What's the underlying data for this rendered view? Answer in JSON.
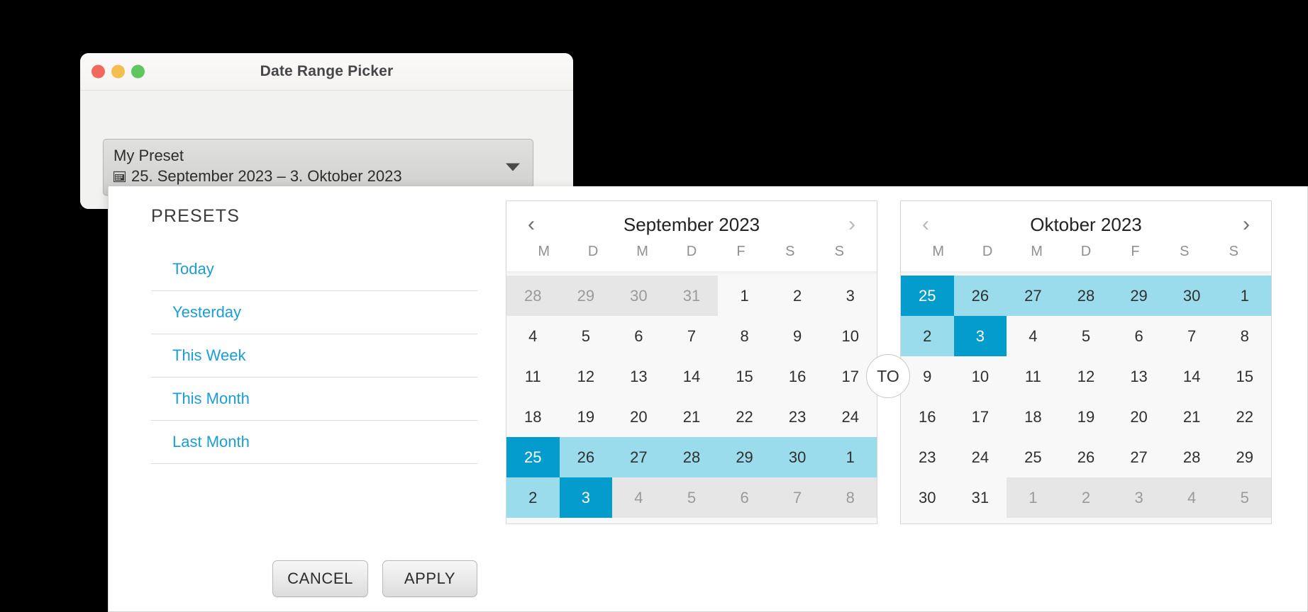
{
  "window": {
    "title": "Date Range Picker",
    "traffic_lights": [
      {
        "name": "close",
        "color": "#ef6a5d"
      },
      {
        "name": "minimize",
        "color": "#f4bd4f"
      },
      {
        "name": "zoom",
        "color": "#5fc75d"
      }
    ]
  },
  "select": {
    "label": "My Preset",
    "range_text": "25. September 2023 – 3. Oktober 2023",
    "icon": "calendar-icon",
    "arrow_icon": "chevron-down-icon"
  },
  "presets": {
    "heading": "PRESETS",
    "items": [
      {
        "label": "Today"
      },
      {
        "label": "Yesterday"
      },
      {
        "label": "This Week"
      },
      {
        "label": "This Month"
      },
      {
        "label": "Last Month"
      }
    ],
    "accent_color": "#1b9dd9"
  },
  "actions": {
    "cancel_label": "CANCEL",
    "apply_label": "APPLY"
  },
  "separator": {
    "label": "TO"
  },
  "colors": {
    "endpoint": "#039ccd",
    "in_range": "#9bdcec",
    "outside": "#e6e6e6",
    "accent": "#1b9dd9"
  },
  "calendars": [
    {
      "month_label": "September 2023",
      "prev_icon": "chevron-left-icon",
      "next_icon": "chevron-right-icon",
      "prev_enabled": true,
      "next_enabled": false,
      "weekdays": [
        "M",
        "D",
        "M",
        "D",
        "F",
        "S",
        "S"
      ],
      "weeks": [
        [
          {
            "n": "28",
            "state": "outside"
          },
          {
            "n": "29",
            "state": "outside"
          },
          {
            "n": "30",
            "state": "outside"
          },
          {
            "n": "31",
            "state": "outside"
          },
          {
            "n": "1",
            "state": "normal"
          },
          {
            "n": "2",
            "state": "normal"
          },
          {
            "n": "3",
            "state": "normal"
          }
        ],
        [
          {
            "n": "4",
            "state": "normal"
          },
          {
            "n": "5",
            "state": "normal"
          },
          {
            "n": "6",
            "state": "normal"
          },
          {
            "n": "7",
            "state": "normal"
          },
          {
            "n": "8",
            "state": "normal"
          },
          {
            "n": "9",
            "state": "normal"
          },
          {
            "n": "10",
            "state": "normal"
          }
        ],
        [
          {
            "n": "11",
            "state": "normal"
          },
          {
            "n": "12",
            "state": "normal"
          },
          {
            "n": "13",
            "state": "normal"
          },
          {
            "n": "14",
            "state": "normal"
          },
          {
            "n": "15",
            "state": "normal"
          },
          {
            "n": "16",
            "state": "normal"
          },
          {
            "n": "17",
            "state": "normal"
          }
        ],
        [
          {
            "n": "18",
            "state": "normal"
          },
          {
            "n": "19",
            "state": "normal"
          },
          {
            "n": "20",
            "state": "normal"
          },
          {
            "n": "21",
            "state": "normal"
          },
          {
            "n": "22",
            "state": "normal"
          },
          {
            "n": "23",
            "state": "normal"
          },
          {
            "n": "24",
            "state": "normal"
          }
        ],
        [
          {
            "n": "25",
            "state": "endpoint"
          },
          {
            "n": "26",
            "state": "in-range"
          },
          {
            "n": "27",
            "state": "in-range"
          },
          {
            "n": "28",
            "state": "in-range"
          },
          {
            "n": "29",
            "state": "in-range"
          },
          {
            "n": "30",
            "state": "in-range"
          },
          {
            "n": "1",
            "state": "in-range"
          }
        ],
        [
          {
            "n": "2",
            "state": "in-range"
          },
          {
            "n": "3",
            "state": "endpoint"
          },
          {
            "n": "4",
            "state": "outside"
          },
          {
            "n": "5",
            "state": "outside"
          },
          {
            "n": "6",
            "state": "outside"
          },
          {
            "n": "7",
            "state": "outside"
          },
          {
            "n": "8",
            "state": "outside"
          }
        ]
      ]
    },
    {
      "month_label": "Oktober 2023",
      "prev_icon": "chevron-left-icon",
      "next_icon": "chevron-right-icon",
      "prev_enabled": false,
      "next_enabled": true,
      "weekdays": [
        "M",
        "D",
        "M",
        "D",
        "F",
        "S",
        "S"
      ],
      "weeks": [
        [
          {
            "n": "25",
            "state": "endpoint"
          },
          {
            "n": "26",
            "state": "in-range"
          },
          {
            "n": "27",
            "state": "in-range"
          },
          {
            "n": "28",
            "state": "in-range"
          },
          {
            "n": "29",
            "state": "in-range"
          },
          {
            "n": "30",
            "state": "in-range"
          },
          {
            "n": "1",
            "state": "in-range"
          }
        ],
        [
          {
            "n": "2",
            "state": "in-range"
          },
          {
            "n": "3",
            "state": "endpoint"
          },
          {
            "n": "4",
            "state": "normal"
          },
          {
            "n": "5",
            "state": "normal"
          },
          {
            "n": "6",
            "state": "normal"
          },
          {
            "n": "7",
            "state": "normal"
          },
          {
            "n": "8",
            "state": "normal"
          }
        ],
        [
          {
            "n": "9",
            "state": "normal"
          },
          {
            "n": "10",
            "state": "normal"
          },
          {
            "n": "11",
            "state": "normal"
          },
          {
            "n": "12",
            "state": "normal"
          },
          {
            "n": "13",
            "state": "normal"
          },
          {
            "n": "14",
            "state": "normal"
          },
          {
            "n": "15",
            "state": "normal"
          }
        ],
        [
          {
            "n": "16",
            "state": "normal"
          },
          {
            "n": "17",
            "state": "normal"
          },
          {
            "n": "18",
            "state": "normal"
          },
          {
            "n": "19",
            "state": "normal"
          },
          {
            "n": "20",
            "state": "normal"
          },
          {
            "n": "21",
            "state": "normal"
          },
          {
            "n": "22",
            "state": "normal"
          }
        ],
        [
          {
            "n": "23",
            "state": "normal"
          },
          {
            "n": "24",
            "state": "normal"
          },
          {
            "n": "25",
            "state": "normal"
          },
          {
            "n": "26",
            "state": "normal"
          },
          {
            "n": "27",
            "state": "normal"
          },
          {
            "n": "28",
            "state": "normal"
          },
          {
            "n": "29",
            "state": "normal"
          }
        ],
        [
          {
            "n": "30",
            "state": "normal"
          },
          {
            "n": "31",
            "state": "normal"
          },
          {
            "n": "1",
            "state": "outside"
          },
          {
            "n": "2",
            "state": "outside"
          },
          {
            "n": "3",
            "state": "outside"
          },
          {
            "n": "4",
            "state": "outside"
          },
          {
            "n": "5",
            "state": "outside"
          }
        ]
      ]
    }
  ]
}
